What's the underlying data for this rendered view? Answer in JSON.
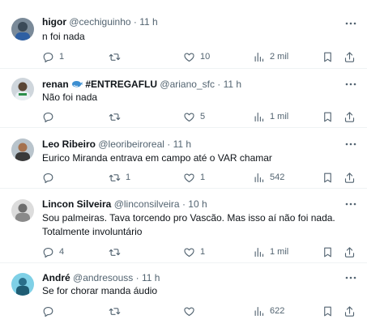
{
  "tweets": [
    {
      "name": "higor",
      "handle": "@cechiguinho",
      "time": "11 h",
      "text_lines": [
        "n foi nada"
      ],
      "replies": "1",
      "retweets": "",
      "likes": "10",
      "views": "2 mil",
      "avatar": "avatar-higor"
    },
    {
      "name": "renan",
      "name_suffix": "#ENTREGAFLU",
      "handle": "@ariano_sfc",
      "time": "11 h",
      "text_lines": [
        "Não foi nada"
      ],
      "replies": "",
      "retweets": "",
      "likes": "5",
      "views": "1 mil",
      "avatar": "avatar-renan",
      "name_emoji": "whale-icon"
    },
    {
      "name": "Leo Ribeiro",
      "handle": "@leoribeiroreal",
      "time": "11 h",
      "text_lines": [
        "Eurico Miranda entrava em campo até o VAR chamar"
      ],
      "replies": "",
      "retweets": "1",
      "likes": "1",
      "views": "542",
      "avatar": "avatar-leo"
    },
    {
      "name": "Lincon Silveira",
      "handle": "@linconsilveira",
      "time": "10 h",
      "text_lines": [
        "Sou palmeiras. Tava torcendo pro Vascão. Mas isso aí não foi nada.",
        "Totalmente involuntário"
      ],
      "replies": "4",
      "retweets": "",
      "likes": "1",
      "views": "1 mil",
      "avatar": "avatar-lincon"
    },
    {
      "name": "André",
      "handle": "@andresouss",
      "time": "11 h",
      "text_lines": [
        "Se for chorar manda áudio"
      ],
      "replies": "",
      "retweets": "",
      "likes": "",
      "views": "622",
      "avatar": "avatar-andre"
    }
  ],
  "separator": "·",
  "colors": {
    "text": "#0f1419",
    "secondary": "#536471",
    "border": "#eff3f4"
  }
}
